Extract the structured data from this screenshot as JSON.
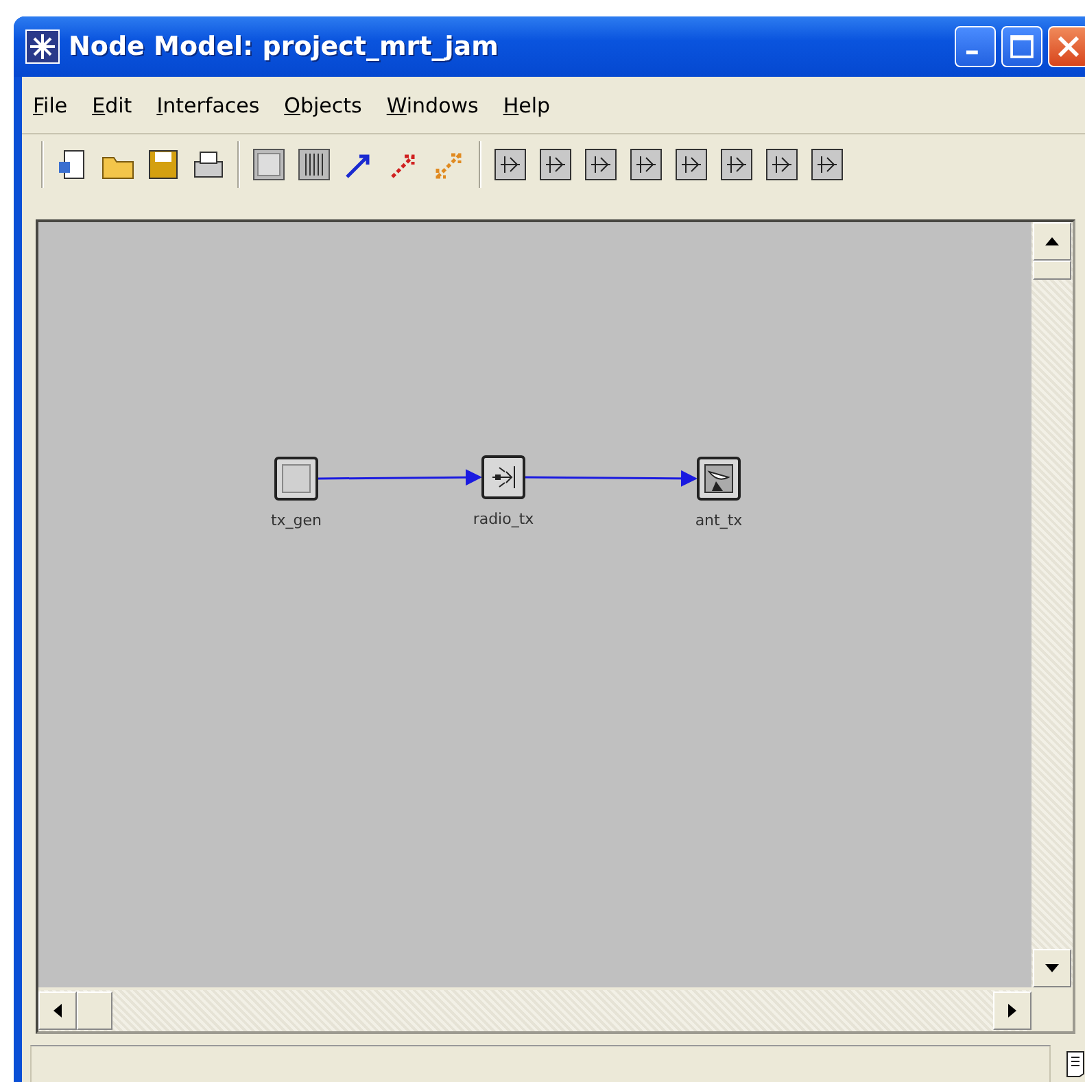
{
  "window": {
    "title": "Node Model: project_mrt_jam"
  },
  "menu": [
    {
      "label": "File"
    },
    {
      "label": "Edit"
    },
    {
      "label": "Interfaces"
    },
    {
      "label": "Objects"
    },
    {
      "label": "Windows"
    },
    {
      "label": "Help"
    }
  ],
  "nodes": [
    {
      "label": "tx_gen",
      "kind": "processor"
    },
    {
      "label": "radio_tx",
      "kind": "transmitter"
    },
    {
      "label": "ant_tx",
      "kind": "antenna"
    }
  ]
}
